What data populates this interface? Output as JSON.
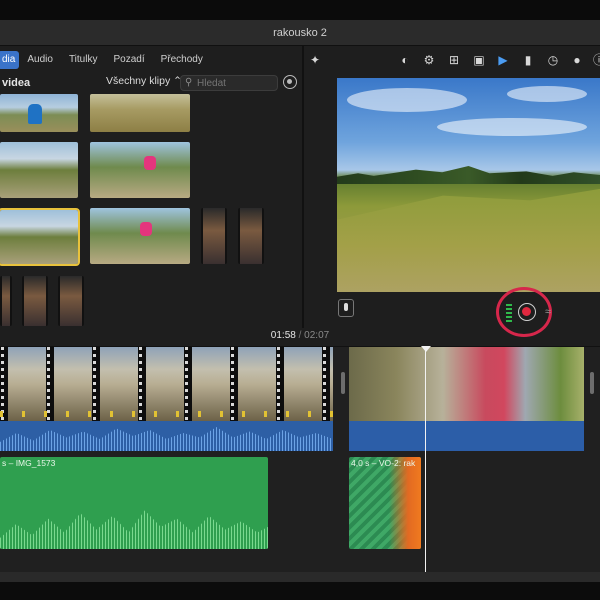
{
  "window": {
    "title": "rakousko 2"
  },
  "library": {
    "tabs": [
      {
        "label": "dia",
        "active": true
      },
      {
        "label": "Audio",
        "active": false
      },
      {
        "label": "Titulky",
        "active": false
      },
      {
        "label": "Pozadí",
        "active": false
      },
      {
        "label": "Přechody",
        "active": false
      }
    ],
    "section_title": "videa",
    "clip_filter": "Všechny klipy ⌃",
    "search": {
      "placeholder": "Hledat",
      "value": ""
    }
  },
  "viewer": {
    "tools": [
      "magic-wand-icon",
      "color-balance-icon",
      "color-correction-icon",
      "crop-icon",
      "stabilization-icon",
      "volume-icon",
      "equalizer-icon",
      "speed-icon",
      "filter-icon",
      "info-icon"
    ]
  },
  "playback": {
    "current_time": "01:58",
    "separator": "/",
    "total_time": "02:07"
  },
  "timeline": {
    "audio_clip_label": "s – IMG_1573",
    "voiceover_clip_label": "4,0 s – VO-2: rak"
  },
  "colors": {
    "accent": "#3a73c9",
    "record": "#e0283f",
    "highlight": "#d6274b",
    "audio": "#2f9f4f",
    "voiceover_fade": "#e26a22"
  }
}
